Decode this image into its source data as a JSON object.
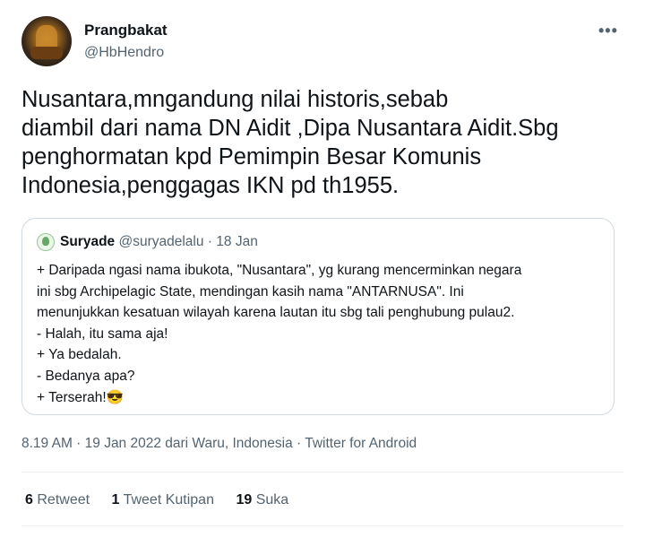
{
  "tweet": {
    "display_name": "Prangbakat",
    "handle": "@HbHendro",
    "more_label": "•••",
    "text": "Nusantara,mngandung nilai historis,sebab\ndiambil dari nama DN Aidit ,Dipa Nusantara Aidit.Sbg\npenghormatan kpd Pemimpin Besar Komunis\nIndonesia,penggagas IKN pd th1955."
  },
  "quote": {
    "display_name": "Suryade",
    "handle": "@suryadelalu",
    "separator": "·",
    "date": "18 Jan",
    "text": "+ Daripada ngasi nama ibukota, \"Nusantara\", yg kurang mencerminkan negara\nini sbg Archipelagic State, mendingan kasih nama \"ANTARNUSA\". Ini\nmenunjukkan kesatuan wilayah karena lautan itu sbg tali penghubung pulau2.\n- Halah, itu sama aja!\n+ Ya bedalah.\n- Bedanya apa?\n+ Terserah!😎"
  },
  "meta": {
    "text": "8.19 AM · 19 Jan 2022 dari Waru, Indonesia · Twitter for Android"
  },
  "stats": {
    "retweets_count": "6",
    "retweets_label": "Retweet",
    "quotes_count": "1",
    "quotes_label": "Tweet Kutipan",
    "likes_count": "19",
    "likes_label": "Suka"
  }
}
